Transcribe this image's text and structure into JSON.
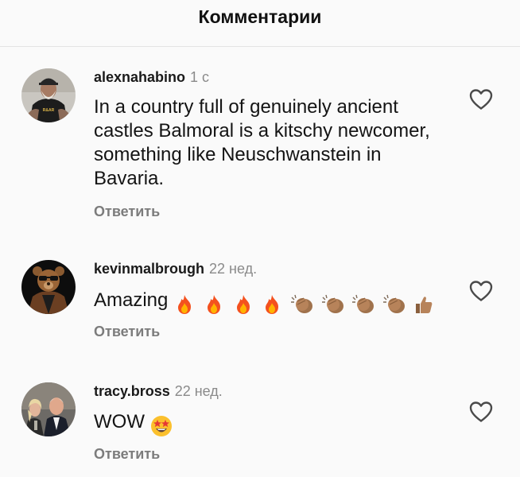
{
  "header": {
    "title": "Комментарии"
  },
  "comments": [
    {
      "username": "alexnahabino",
      "time": "1 с",
      "text": "In a country full of genuinely ancient castles Balmoral is a kitschy newcomer, something like Neuschwanstein in Bavaria.",
      "reply_label": "Ответить",
      "avatar_shirt_text": "R&AR"
    },
    {
      "username": "kevinmalbrough",
      "time": "22 нед.",
      "text": "Amazing",
      "reply_label": "Ответить",
      "emojis": [
        "fire",
        "fire",
        "fire",
        "fire",
        "clapping-hands",
        "clapping-hands",
        "clapping-hands",
        "clapping-hands",
        "thumbs-up"
      ]
    },
    {
      "username": "tracy.bross",
      "time": "22 нед.",
      "text": "WOW",
      "reply_label": "Ответить",
      "emojis": [
        "star-struck"
      ]
    }
  ],
  "colors": {
    "background": "#fafafa",
    "text": "#141414",
    "secondary": "#8a8a8a",
    "reply": "#7c7c7c",
    "divider": "#e3e3e3"
  }
}
